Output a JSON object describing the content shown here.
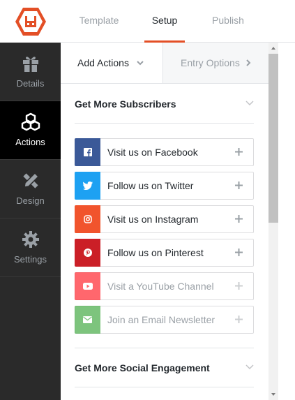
{
  "logo": {
    "name": "rabbit-logo-icon",
    "color": "#e34f26"
  },
  "top_tabs": [
    {
      "label": "Template",
      "active": false
    },
    {
      "label": "Setup",
      "active": true
    },
    {
      "label": "Publish",
      "active": false
    }
  ],
  "sidebar": {
    "items": [
      {
        "label": "Details",
        "icon": "gift-icon",
        "active": false
      },
      {
        "label": "Actions",
        "icon": "cubes-icon",
        "active": true
      },
      {
        "label": "Design",
        "icon": "pencil-ruler-icon",
        "active": false
      },
      {
        "label": "Settings",
        "icon": "gear-icon",
        "active": false
      }
    ]
  },
  "subtabs": {
    "add_actions": "Add Actions",
    "entry_options": "Entry Options"
  },
  "sections": {
    "subscribers": {
      "title": "Get More Subscribers",
      "actions": [
        {
          "label": "Visit us on Facebook",
          "icon": "facebook-icon",
          "color": "#3b5998",
          "disabled": false
        },
        {
          "label": "Follow us on Twitter",
          "icon": "twitter-icon",
          "color": "#1da1f2",
          "disabled": false
        },
        {
          "label": "Visit us on Instagram",
          "icon": "instagram-icon",
          "color": "#f1542d",
          "disabled": false
        },
        {
          "label": "Follow us on Pinterest",
          "icon": "pinterest-icon",
          "color": "#cb1f27",
          "disabled": false
        },
        {
          "label": "Visit a YouTube Channel",
          "icon": "youtube-icon",
          "color": "#ff2e36",
          "disabled": true
        },
        {
          "label": "Join an Email Newsletter",
          "icon": "envelope-icon",
          "color": "#4cae4c",
          "disabled": true
        }
      ]
    },
    "social": {
      "title": "Get More Social Engagement"
    }
  },
  "colors": {
    "accent": "#e34f26",
    "sidebar_bg": "#2a2a2a",
    "sidebar_active_bg": "#000000"
  }
}
